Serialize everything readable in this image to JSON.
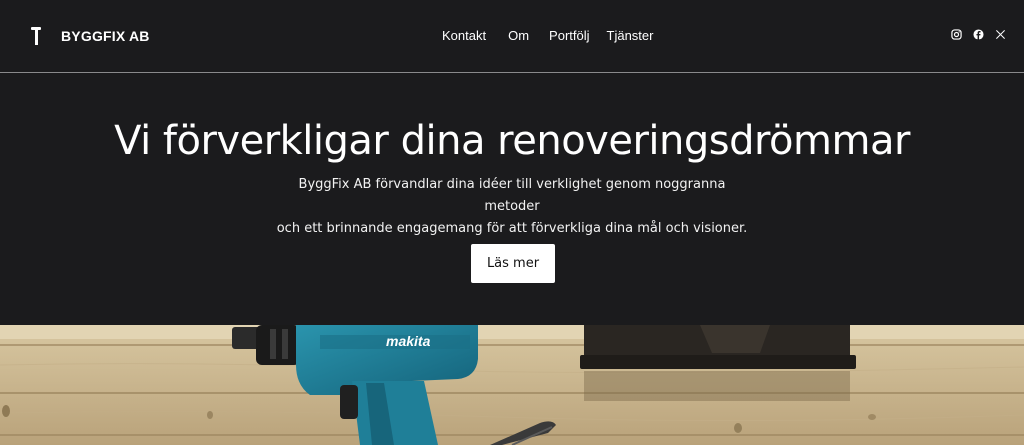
{
  "header": {
    "brand_name": "BYGGFIX AB",
    "brand_icon": "hammer-icon",
    "nav": [
      {
        "label": "Kontakt"
      },
      {
        "label": "Om"
      },
      {
        "label": "Portfölj"
      },
      {
        "label": "Tjänster"
      }
    ],
    "social": [
      "instagram-icon",
      "facebook-icon",
      "x-icon"
    ]
  },
  "hero": {
    "title": "Vi förverkligar dina renoveringsdrömmar",
    "subtitle_line1": "ByggFix AB förvandlar dina idéer till verklighet genom noggranna metoder",
    "subtitle_line2": "och ett brinnande engagemang för att förverkliga dina mål och visioner.",
    "cta_label": "Läs mer"
  },
  "photo": {
    "drill_brand": "makita"
  },
  "colors": {
    "background": "#1b1b1d",
    "text": "#ffffff",
    "button_bg": "#ffffff",
    "button_text": "#111111",
    "drill_teal": "#1f7f98"
  }
}
